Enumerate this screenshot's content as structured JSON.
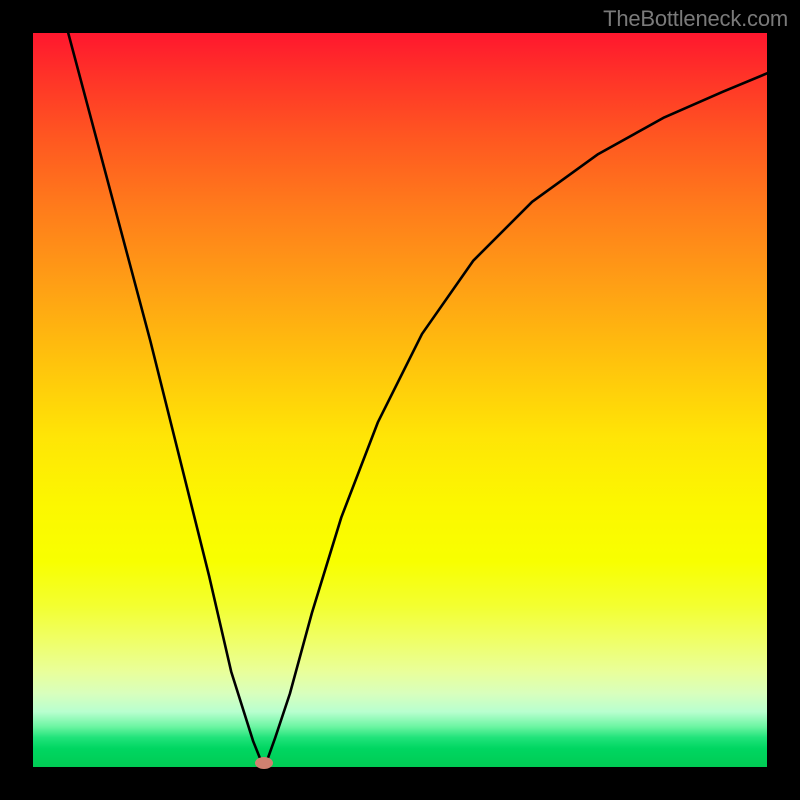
{
  "watermark": "TheBottleneck.com",
  "colors": {
    "frame_bg": "#000000",
    "curve_stroke": "#000000",
    "marker_fill": "#d08070",
    "gradient_top": "#ff172e",
    "gradient_bottom": "#00cc54"
  },
  "chart_data": {
    "type": "line",
    "title": "",
    "xlabel": "",
    "ylabel": "",
    "xlim": [
      0,
      100
    ],
    "ylim": [
      0,
      100
    ],
    "grid": false,
    "x": [
      0,
      4,
      8,
      12,
      16,
      20,
      24,
      27,
      30,
      31,
      31.5,
      32,
      33,
      35,
      38,
      42,
      47,
      53,
      60,
      68,
      77,
      86,
      94,
      100
    ],
    "values": [
      118,
      103,
      88,
      73,
      58,
      42,
      26,
      13,
      3.5,
      1.0,
      0.6,
      1.2,
      4,
      10,
      21,
      34,
      47,
      59,
      69,
      77,
      83.5,
      88.5,
      92,
      94.5
    ],
    "marker": {
      "x": 31.5,
      "y": 0.6
    },
    "annotations": []
  }
}
